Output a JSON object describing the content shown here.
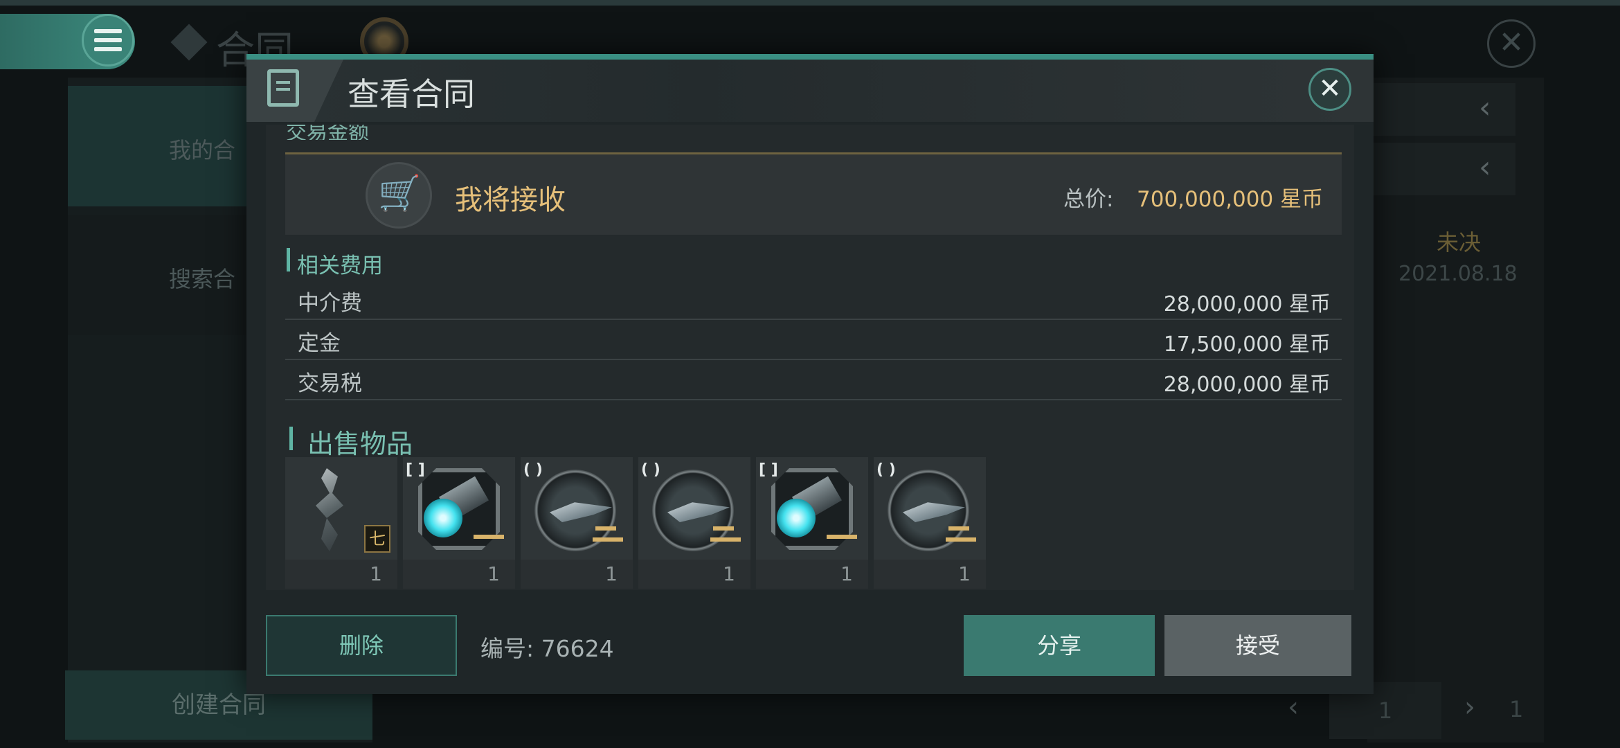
{
  "background": {
    "page_title": "合同",
    "sidebar": [
      {
        "label": "我的合"
      },
      {
        "label": "搜索合"
      }
    ],
    "create_button": "创建合同",
    "row_status": "未决",
    "row_date": "2021.08.18",
    "pager": {
      "current": "1",
      "total": "1"
    }
  },
  "modal": {
    "title": "查看合同",
    "cut_section_label": "交易金额",
    "receive": {
      "label": "我将接收",
      "total_label": "总价:",
      "total_value": "700,000,000 星币"
    },
    "fees": {
      "title": "相关费用",
      "rows": [
        {
          "name": "中介费",
          "value": "28,000,000 星币"
        },
        {
          "name": "定金",
          "value": "17,500,000 星币"
        },
        {
          "name": "交易税",
          "value": "28,000,000 星币"
        }
      ]
    },
    "items": {
      "title": "出售物品",
      "list": [
        {
          "type": "module",
          "slot": "",
          "badge": "七",
          "count": "1"
        },
        {
          "type": "charge",
          "slot": "[ ]",
          "count": "1"
        },
        {
          "type": "ship",
          "slot": "( )",
          "count": "1"
        },
        {
          "type": "ship",
          "slot": "( )",
          "count": "1"
        },
        {
          "type": "charge",
          "slot": "[ ]",
          "count": "1"
        },
        {
          "type": "ship",
          "slot": "( )",
          "count": "1"
        }
      ]
    },
    "footer": {
      "delete_label": "删除",
      "serial": "编号: 76624",
      "share_label": "分享",
      "accept_label": "接受"
    }
  },
  "colors": {
    "accent": "#3a8f83",
    "gold": "#e6c07a"
  }
}
